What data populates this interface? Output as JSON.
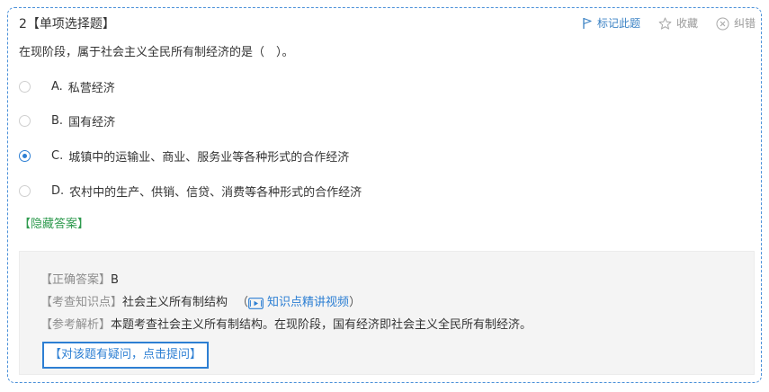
{
  "question": {
    "number": "2",
    "type_label": "【单项选择题】",
    "stem": "在现阶段，属于社会主义全民所有制经济的是（　）。"
  },
  "actions": {
    "mark": "标记此题",
    "favorite": "收藏",
    "report": "纠错"
  },
  "options": [
    {
      "letter": "A.",
      "text": "私营经济",
      "selected": false
    },
    {
      "letter": "B.",
      "text": "国有经济",
      "selected": false
    },
    {
      "letter": "C.",
      "text": "城镇中的运输业、商业、服务业等各种形式的合作经济",
      "selected": true
    },
    {
      "letter": "D.",
      "text": "农村中的生产、供销、信贷、消费等各种形式的合作经济",
      "selected": false
    }
  ],
  "toggle_answer": "【隐藏答案】",
  "answer": {
    "correct_label": "【正确答案】",
    "correct_value": "B",
    "knowledge_label": "【考查知识点】",
    "knowledge_value": "社会主义所有制结构",
    "paren_open": "（",
    "video_link": "知识点精讲视频",
    "paren_close": "）",
    "analysis_label": "【参考解析】",
    "analysis_value": "本题考查社会主义所有制结构。在现阶段，国有经济即社会主义全民所有制经济。"
  },
  "ask_button": "【对该题有疑问，点击提问】",
  "colors": {
    "accent": "#2d7fd3",
    "green": "#2e9a4e",
    "border": "#4a90d9"
  }
}
